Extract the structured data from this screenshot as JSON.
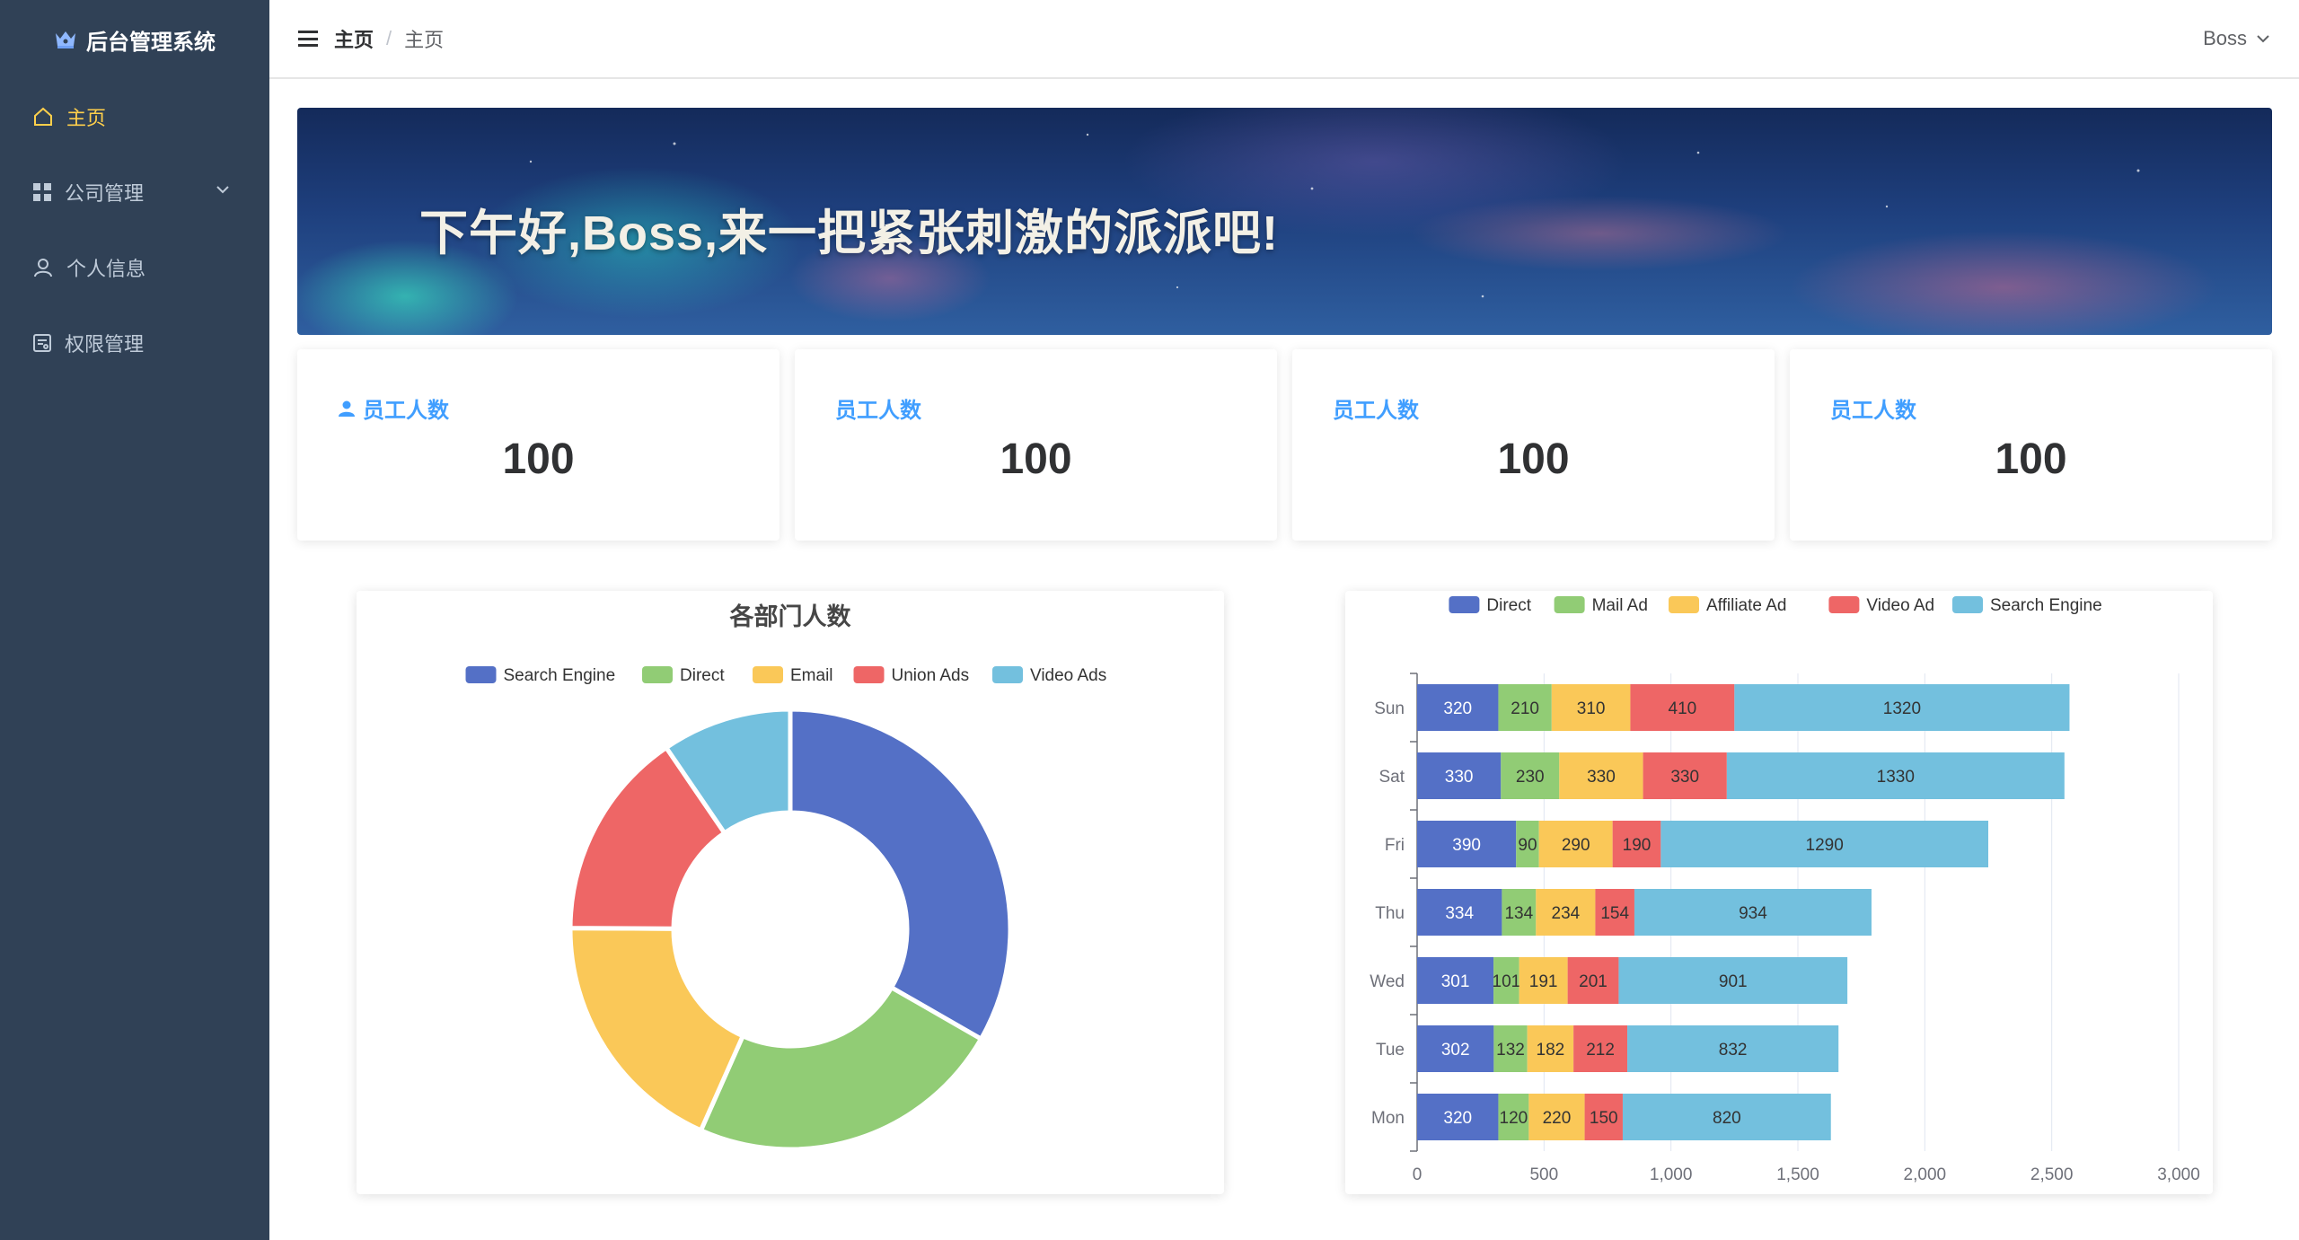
{
  "sidebar": {
    "logo_text": "后台管理系统",
    "items": [
      {
        "label": "主页",
        "icon": "home-icon",
        "active": true
      },
      {
        "label": "公司管理",
        "icon": "grid-icon",
        "has_submenu": true
      },
      {
        "label": "个人信息",
        "icon": "user-icon"
      },
      {
        "label": "权限管理",
        "icon": "permission-icon"
      }
    ]
  },
  "header": {
    "breadcrumb": [
      "主页",
      "主页"
    ],
    "breadcrumb_separator": "/",
    "user_name": "Boss"
  },
  "banner": {
    "greeting": "下午好,Boss,来一把紧张刺激的派派吧!"
  },
  "stats": [
    {
      "label": "员工人数",
      "value": "100",
      "has_icon": true
    },
    {
      "label": "员工人数",
      "value": "100"
    },
    {
      "label": "员工人数",
      "value": "100"
    },
    {
      "label": "员工人数",
      "value": "100"
    }
  ],
  "colors": {
    "accent": "#409eff",
    "sidebar_bg": "#304156",
    "active_menu": "#ffd04b",
    "series": [
      "#5470c6",
      "#91cc75",
      "#fac858",
      "#ee6666",
      "#73c0de"
    ]
  },
  "chart_data": [
    {
      "type": "pie",
      "title": "各部门人数",
      "legend": [
        "Search Engine",
        "Direct",
        "Email",
        "Union Ads",
        "Video Ads"
      ],
      "legend_position": "top-center",
      "slices": [
        {
          "name": "Search Engine",
          "value": 1048
        },
        {
          "name": "Direct",
          "value": 735
        },
        {
          "name": "Email",
          "value": 580
        },
        {
          "name": "Union Ads",
          "value": 484
        },
        {
          "name": "Video Ads",
          "value": 300
        }
      ]
    },
    {
      "type": "bar",
      "orientation": "horizontal",
      "stacked": true,
      "legend_position": "top-center",
      "categories": [
        "Mon",
        "Tue",
        "Wed",
        "Thu",
        "Fri",
        "Sat",
        "Sun"
      ],
      "series": [
        {
          "name": "Direct",
          "values": [
            320,
            302,
            301,
            334,
            390,
            330,
            320
          ]
        },
        {
          "name": "Mail Ad",
          "values": [
            120,
            132,
            101,
            134,
            90,
            230,
            210
          ]
        },
        {
          "name": "Affiliate Ad",
          "values": [
            220,
            182,
            191,
            234,
            290,
            330,
            310
          ]
        },
        {
          "name": "Video Ad",
          "values": [
            150,
            212,
            201,
            154,
            190,
            330,
            410
          ]
        },
        {
          "name": "Search Engine",
          "values": [
            820,
            832,
            901,
            934,
            1290,
            1330,
            1320
          ]
        }
      ],
      "xlim": [
        0,
        3000
      ],
      "xticks": [
        "0",
        "500",
        "1,000",
        "1,500",
        "2,000",
        "2,500",
        "3,000"
      ],
      "grid": true
    }
  ]
}
